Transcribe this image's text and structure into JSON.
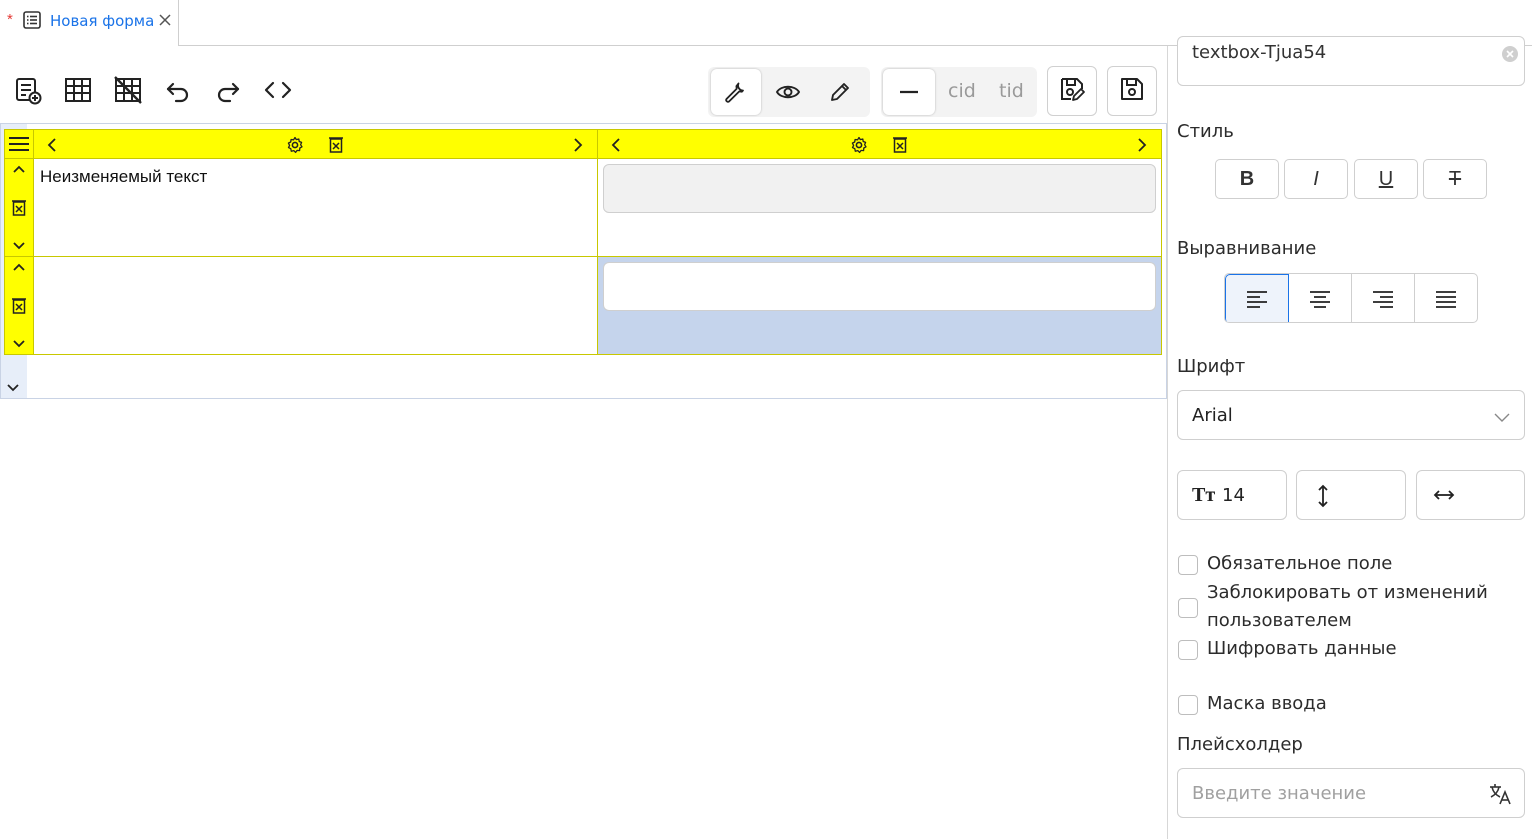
{
  "tab": {
    "modified_marker": "*",
    "title": "Новая форма",
    "icon": "form-icon",
    "close_icon": "close-icon"
  },
  "toolbar": {
    "left_icons": [
      "add-form-icon",
      "table-icon",
      "delete-table-icon",
      "undo-icon",
      "redo-icon",
      "code-icon"
    ],
    "mode_icons": [
      "settings-wrench-icon",
      "preview-eye-icon",
      "edit-pencil-icon"
    ],
    "cid_label": "cid",
    "tid_label": "tid",
    "save_icons": [
      "save-as-icon",
      "save-icon"
    ]
  },
  "grid": {
    "row1_text": "Неизменяемый текст",
    "header_color": "#ffff00",
    "selected_color": "#c5d4ec"
  },
  "panel": {
    "id_value": "textbox-Tjua54",
    "style_label": "Стиль",
    "style_buttons": [
      "B",
      "I",
      "U",
      "T"
    ],
    "align_label": "Выравнивание",
    "font_label": "Шрифт",
    "font_value": "Arial",
    "font_size_value": "14",
    "font_size_icon": "Тт",
    "checkboxes": {
      "required": "Обязательное поле",
      "lock_line1": "Заблокировать от изменений",
      "lock_line2": "пользователем",
      "encrypt": "Шифровать данные",
      "mask": "Маска ввода"
    },
    "placeholder_label": "Плейсхолдер",
    "placeholder_input": "Введите значение"
  }
}
